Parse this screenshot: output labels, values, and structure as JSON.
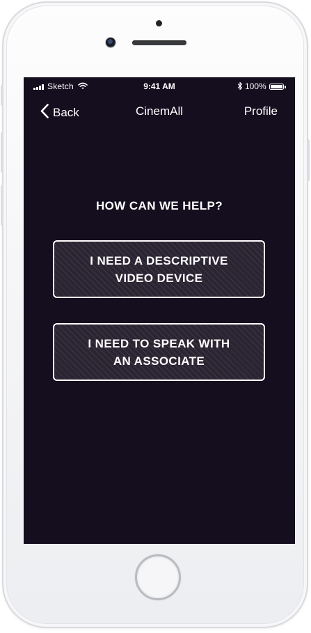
{
  "status_bar": {
    "carrier": "Sketch",
    "time": "9:41 AM",
    "battery": "100%",
    "icons": [
      "signal-icon",
      "wifi-icon",
      "bluetooth-icon",
      "battery-icon"
    ]
  },
  "nav": {
    "back_label": "Back",
    "title": "CinemAll",
    "profile_label": "Profile"
  },
  "main": {
    "heading": "HOW CAN WE HELP?",
    "options": [
      {
        "label": "I NEED A DESCRIPTIVE\nVIDEO DEVICE"
      },
      {
        "label": "I NEED TO SPEAK WITH\nAN ASSOCIATE"
      }
    ]
  },
  "colors": {
    "background": "#140e1f",
    "button_fill": "#2b2432",
    "text": "#ffffff"
  }
}
